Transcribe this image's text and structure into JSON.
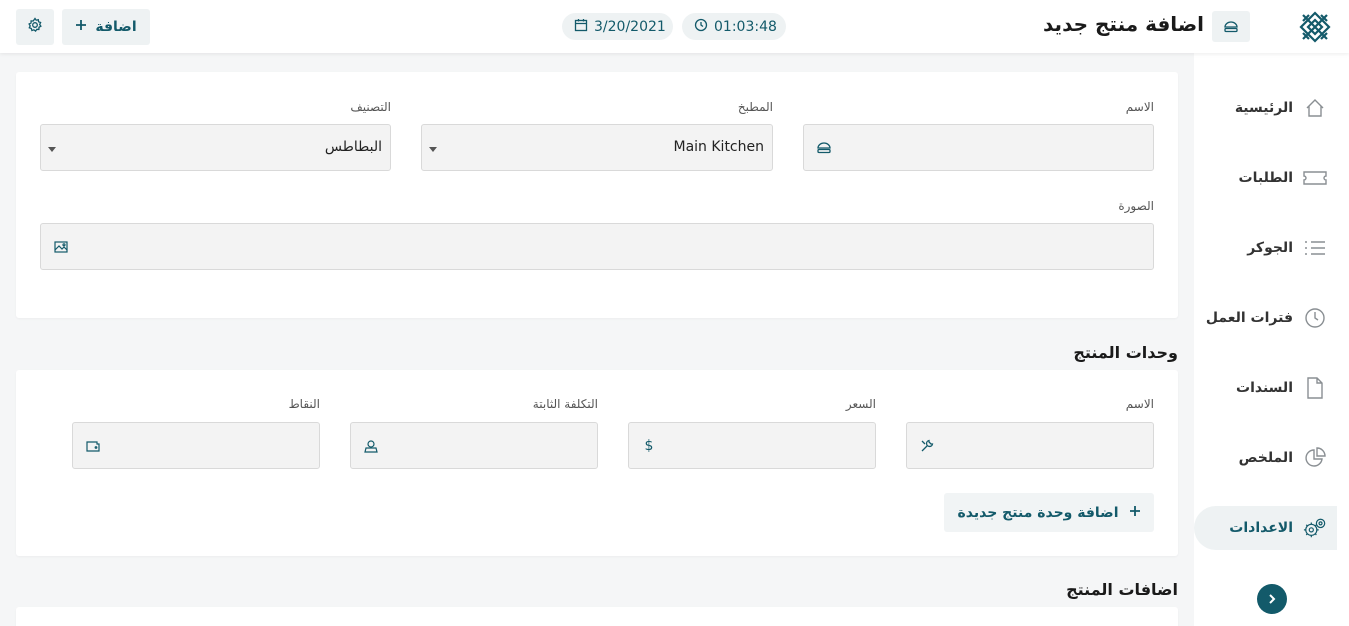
{
  "header": {
    "title": "اضافة منتج جديد",
    "time": "01:03:48",
    "date": "3/20/2021",
    "add_label": "اضافة"
  },
  "sidebar": {
    "items": [
      {
        "label": "الرئيسية",
        "icon": "home-icon"
      },
      {
        "label": "الطلبات",
        "icon": "ticket-icon"
      },
      {
        "label": "الجوكر",
        "icon": "list-icon"
      },
      {
        "label": "فترات العمل",
        "icon": "clock-icon"
      },
      {
        "label": "السندات",
        "icon": "document-icon"
      },
      {
        "label": "الملخص",
        "icon": "pie-chart-icon"
      },
      {
        "label": "الاعدادات",
        "icon": "gears-icon",
        "active": true
      }
    ]
  },
  "product_form": {
    "name_label": "الاسم",
    "name_value": "",
    "kitchen_label": "المطبخ",
    "kitchen_value": "Main Kitchen",
    "category_label": "التصنيف",
    "category_value": "البطاطس",
    "image_label": "الصورة",
    "image_value": ""
  },
  "units_section": {
    "title": "وحدات المنتج",
    "name_label": "الاسم",
    "price_label": "السعر",
    "fixed_cost_label": "التكلفة الثابتة",
    "points_label": "النقاط",
    "add_unit_label": "اضافة وحدة منتج جديدة"
  },
  "addons_section": {
    "title": "اضافات المنتج"
  },
  "colors": {
    "accent": "#135a6a",
    "light_bg": "#eef2f3"
  }
}
